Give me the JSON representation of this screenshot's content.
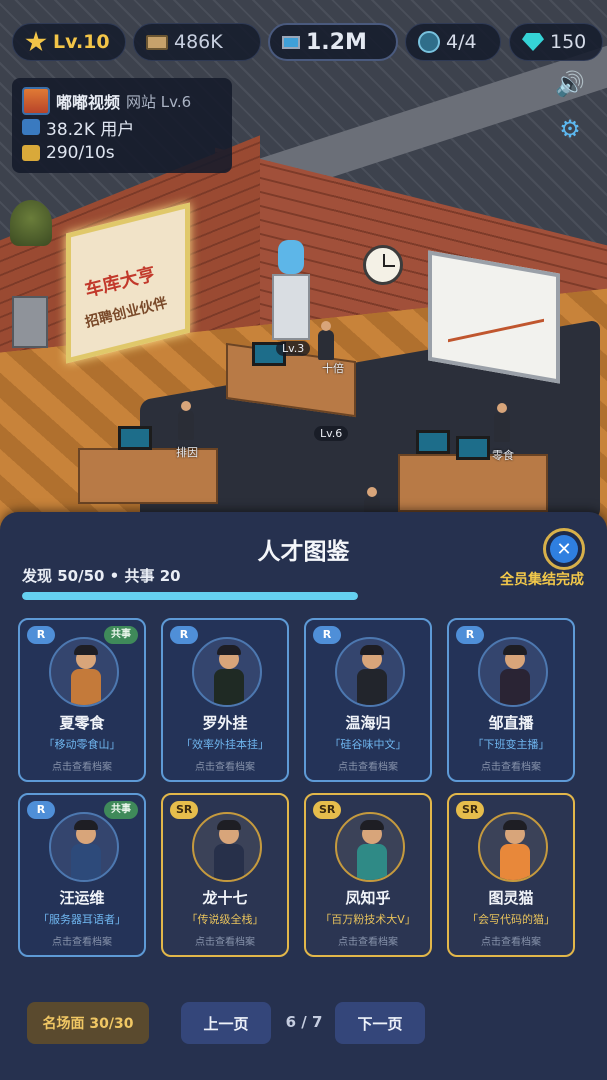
{
  "hud": {
    "level": "Lv.10",
    "cash": "486K",
    "users": "1.2M",
    "staff": "4/4",
    "gems": "150"
  },
  "site": {
    "name": "嘟嘟视频",
    "level": "网站 Lv.6",
    "users": "38.2K 用户",
    "rate": "290/10s"
  },
  "scene": {
    "sign_line1": "车库大亨",
    "sign_line2": "招聘创业伙伴",
    "desk_tags": [
      "Lv.3",
      "Lv.6"
    ],
    "worker_labels": [
      "十倍",
      "排因",
      "零食"
    ]
  },
  "panel": {
    "title": "人才图鉴",
    "discover": "发现 50/50 • 共事 20",
    "complete": "全员集结完成",
    "progress": 1.0
  },
  "cards": [
    {
      "rarity": "R",
      "shared": "共事",
      "name": "夏零食",
      "title": "「移动零食山」",
      "hint": "点击查看档案",
      "sr": false,
      "body_color": "#c47a3a"
    },
    {
      "rarity": "R",
      "shared": "",
      "name": "罗外挂",
      "title": "「效率外挂本挂」",
      "hint": "点击查看档案",
      "sr": false,
      "body_color": "#1f2a24"
    },
    {
      "rarity": "R",
      "shared": "",
      "name": "温海归",
      "title": "「硅谷味中文」",
      "hint": "点击查看档案",
      "sr": false,
      "body_color": "#22252c"
    },
    {
      "rarity": "R",
      "shared": "",
      "name": "邹直播",
      "title": "「下班变主播」",
      "hint": "点击查看档案",
      "sr": false,
      "body_color": "#2a2434"
    },
    {
      "rarity": "R",
      "shared": "共事",
      "name": "汪运维",
      "title": "「服务器耳语者」",
      "hint": "点击查看档案",
      "sr": false,
      "body_color": "#2d4a7a"
    },
    {
      "rarity": "SR",
      "shared": "",
      "name": "龙十七",
      "title": "「传说级全栈」",
      "hint": "点击查看档案",
      "sr": true,
      "body_color": "#27304a"
    },
    {
      "rarity": "SR",
      "shared": "",
      "name": "凤知乎",
      "title": "「百万粉技术大V」",
      "hint": "点击查看档案",
      "sr": true,
      "body_color": "#2f8a86"
    },
    {
      "rarity": "SR",
      "shared": "",
      "name": "图灵猫",
      "title": "「会写代码的猫」",
      "hint": "点击查看档案",
      "sr": true,
      "body_color": "#e8883a"
    }
  ],
  "footer": {
    "scenes": "名场面 30/30",
    "prev": "上一页",
    "page": "6 / 7",
    "next": "下一页"
  },
  "icons": {
    "level": "star-icon",
    "cash": "cash-icon",
    "users": "computer-icon",
    "staff": "staff-icon",
    "gems": "gem-icon",
    "sound": "sound-icon",
    "settings": "gear-icon",
    "close": "close-icon"
  },
  "colors": {
    "accent_gold": "#f2c84a",
    "accent_blue": "#65d0f0",
    "panel_bg": "#26314f",
    "r_border": "#5e9ad6",
    "sr_border": "#e2b74a"
  }
}
